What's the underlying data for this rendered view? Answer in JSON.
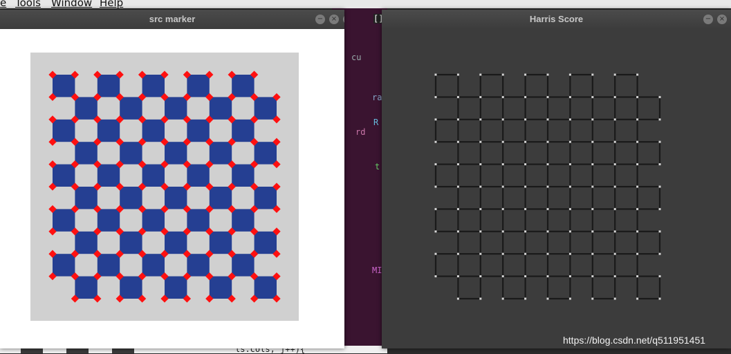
{
  "background_app": {
    "menu": [
      "e",
      "Tools",
      "Window",
      "Help"
    ],
    "code_fragments": [
      "cu",
      "ra",
      "R",
      "rd",
      "t",
      "MI",
      "[]"
    ],
    "bottom_code": "ls.cols; j++){"
  },
  "windows": {
    "src": {
      "title": "src marker",
      "buttons": [
        "−",
        "×",
        "◫",
        "⊠"
      ]
    },
    "harris": {
      "title": "Harris Score",
      "buttons": [
        "−",
        "×"
      ]
    }
  },
  "checkerboard": {
    "rows": 10,
    "cols": 10,
    "colors": {
      "board": "#d0d0d0",
      "square": "#253f92",
      "marker": "#ff1010",
      "edge": "#1a1a1a",
      "corner": "#d8d8d8"
    }
  },
  "watermark": "https://blog.csdn.net/q511951451"
}
